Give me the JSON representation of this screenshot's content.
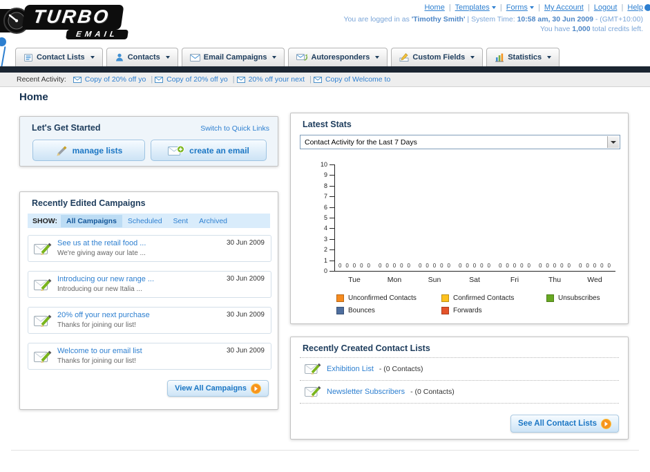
{
  "header": {
    "logo_primary": "TURBO",
    "logo_secondary": "EMAIL",
    "separator": "|",
    "nav": {
      "home": "Home",
      "templates": "Templates",
      "forms": "Forms",
      "my_account": "My Account",
      "logout": "Logout",
      "help": "Help"
    },
    "login": {
      "prefix": "You are logged in as",
      "user": "'Timothy Smith'",
      "system_time_label": "System Time:",
      "system_time": "10:58 am, 30 Jun 2009",
      "timezone": "- (GMT+10:00)"
    },
    "credits": {
      "prefix": "You have",
      "amount": "1,000",
      "suffix": "total credits left."
    }
  },
  "nav_tabs": {
    "items": [
      {
        "label": "Contact Lists"
      },
      {
        "label": "Contacts"
      },
      {
        "label": "Email Campaigns"
      },
      {
        "label": "Autoresponders"
      },
      {
        "label": "Custom Fields"
      },
      {
        "label": "Statistics"
      }
    ]
  },
  "activity": {
    "label": "Recent Activity:",
    "separator": "|",
    "items": [
      {
        "text": "Copy of 20% off yo"
      },
      {
        "text": "Copy of 20% off yo"
      },
      {
        "text": "20% off your next"
      },
      {
        "text": "Copy of Welcome to"
      }
    ]
  },
  "page": {
    "title": "Home"
  },
  "get_started": {
    "title": "Let's Get Started",
    "switch_link": "Switch to Quick Links",
    "manage_lists": "manage lists",
    "create_email": "create an email"
  },
  "campaigns": {
    "title": "Recently Edited Campaigns",
    "show_label": "SHOW:",
    "filters": [
      {
        "label": "All Campaigns",
        "selected": true
      },
      {
        "label": "Scheduled",
        "selected": false
      },
      {
        "label": "Sent",
        "selected": false
      },
      {
        "label": "Archived",
        "selected": false
      }
    ],
    "items": [
      {
        "title": "See us at the retail food ...",
        "subtitle": "We're giving away our late ...",
        "date": "30 Jun 2009"
      },
      {
        "title": "Introducing our new range ...",
        "subtitle": "Introducing our new Italia ...",
        "date": "30 Jun 2009"
      },
      {
        "title": "20% off your next purchase",
        "subtitle": "Thanks for joining our list!",
        "date": "30 Jun 2009"
      },
      {
        "title": "Welcome to our email list",
        "subtitle": "Thanks for joining our list!",
        "date": "30 Jun 2009"
      }
    ],
    "view_all_label": "View All Campaigns"
  },
  "stats": {
    "title": "Latest Stats",
    "selected_option": "Contact Activity for the Last 7 Days"
  },
  "chart_data": {
    "type": "bar",
    "title": "Contact Activity for the Last 7 Days",
    "categories": [
      "Tue",
      "Mon",
      "Sun",
      "Sat",
      "Fri",
      "Thu",
      "Wed"
    ],
    "series": [
      {
        "name": "Unconfirmed Contacts",
        "color": "#f68b1f",
        "values": [
          0,
          0,
          0,
          0,
          0,
          0,
          0
        ]
      },
      {
        "name": "Confirmed Contacts",
        "color": "#fdc11e",
        "values": [
          0,
          0,
          0,
          0,
          0,
          0,
          0
        ]
      },
      {
        "name": "Unsubscribes",
        "color": "#67a822",
        "values": [
          0,
          0,
          0,
          0,
          0,
          0,
          0
        ]
      },
      {
        "name": "Bounces",
        "color": "#4e6e9e",
        "values": [
          0,
          0,
          0,
          0,
          0,
          0,
          0
        ]
      },
      {
        "name": "Forwards",
        "color": "#e4532a",
        "values": [
          0,
          0,
          0,
          0,
          0,
          0,
          0
        ]
      }
    ],
    "ylim": [
      0,
      10
    ],
    "ytick_step": 1,
    "grid": false,
    "legend_position": "bottom",
    "legend_rows": [
      3,
      2
    ]
  },
  "contact_lists": {
    "title": "Recently Created Contact Lists",
    "items": [
      {
        "name": "Exhibition List",
        "count": "- (0 Contacts)"
      },
      {
        "name": "Newsletter Subscribers",
        "count": "- (0 Contacts)"
      }
    ],
    "see_all_label": "See All Contact Lists"
  }
}
